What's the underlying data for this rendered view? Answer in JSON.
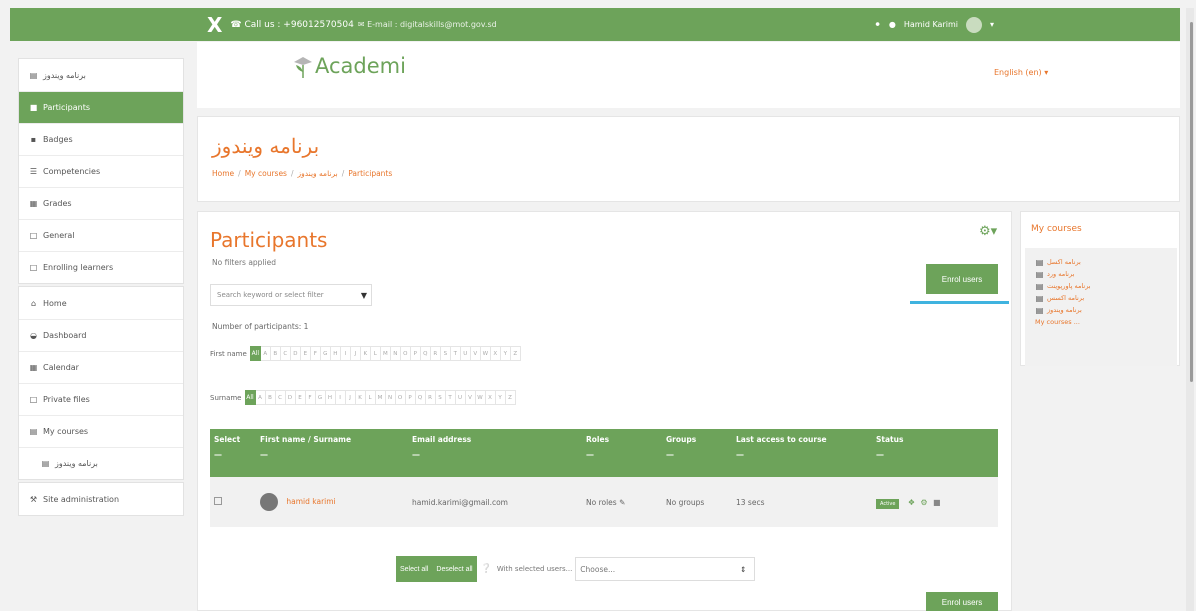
{
  "navbar": {
    "close_glyph": "X",
    "phone": "☎ Call us : +96012570504",
    "contact": "✉ E-mail : digitalskills@mot.gov.sd",
    "username": "Hamid Karimi"
  },
  "drawer": {
    "course_block": [
      {
        "label": "برنامه ویندوز",
        "icon": "graduation-cap-icon",
        "glyph": "▤"
      },
      {
        "label": "Participants",
        "icon": "users-icon",
        "glyph": "■",
        "active": true
      },
      {
        "label": "Badges",
        "icon": "badge-icon",
        "glyph": "▪"
      },
      {
        "label": "Competencies",
        "icon": "checklist-icon",
        "glyph": "☰"
      },
      {
        "label": "Grades",
        "icon": "table-icon",
        "glyph": "▦"
      },
      {
        "label": "General",
        "icon": "folder-icon",
        "glyph": "□"
      },
      {
        "label": "Enrolling learners",
        "icon": "folder-icon",
        "glyph": "□"
      }
    ],
    "nav_block": [
      {
        "label": "Home",
        "icon": "home-icon",
        "glyph": "⌂"
      },
      {
        "label": "Dashboard",
        "icon": "dashboard-icon",
        "glyph": "◒"
      },
      {
        "label": "Calendar",
        "icon": "calendar-icon",
        "glyph": "▦"
      },
      {
        "label": "Private files",
        "icon": "file-icon",
        "glyph": "□"
      },
      {
        "label": "My courses",
        "icon": "graduation-cap-icon",
        "glyph": "▤"
      },
      {
        "label": "برنامه ویندوز",
        "icon": "graduation-cap-icon",
        "glyph": "▤",
        "sub": true
      }
    ],
    "admin_block": [
      {
        "label": "Site administration",
        "icon": "wrench-icon",
        "glyph": "⚒"
      }
    ]
  },
  "header": {
    "logo_text": "Academi",
    "language": "English (en) ▾"
  },
  "course": {
    "title": "برنامه ویندوز",
    "breadcrumb": [
      "Home",
      "My courses",
      "برنامه ویندوز",
      "Participants"
    ]
  },
  "participants": {
    "title": "Participants",
    "no_filters": "No filters applied",
    "enrol_label": "Enrol users",
    "search_placeholder": "Search keyword or select filter",
    "count_text": "Number of participants: 1",
    "firstname_label": "First name",
    "surname_label": "Surname",
    "all_label": "All",
    "letters": [
      "A",
      "B",
      "C",
      "D",
      "E",
      "F",
      "G",
      "H",
      "I",
      "J",
      "K",
      "L",
      "M",
      "N",
      "O",
      "P",
      "Q",
      "R",
      "S",
      "T",
      "U",
      "V",
      "W",
      "X",
      "Y",
      "Z"
    ],
    "columns": [
      {
        "label": "Select"
      },
      {
        "label": "First name / Surname"
      },
      {
        "label": "Email address"
      },
      {
        "label": "Roles"
      },
      {
        "label": "Groups"
      },
      {
        "label": "Last access to course"
      },
      {
        "label": "Status"
      }
    ],
    "row": {
      "name": "hamid karimi",
      "email": "hamid.karimi@gmail.com",
      "roles": "No roles ✎",
      "groups": "No groups",
      "last_access": "13 secs",
      "status": "Active"
    },
    "bulk": {
      "select_all": "Select all",
      "deselect_all": "Deselect all",
      "with_selected": "With selected users...",
      "choose": "Choose..."
    }
  },
  "mycourses": {
    "title": "My courses",
    "items": [
      "برنامه اکسل",
      "برنامه ورد",
      "برنامه پاورپوینت",
      "برنامه اکسس",
      "برنامه ویندوز",
      "My courses ..."
    ]
  },
  "colors": {
    "brand_green": "#6da35a",
    "accent_orange": "#e8762c",
    "highlight_blue": "#3fb3df"
  }
}
